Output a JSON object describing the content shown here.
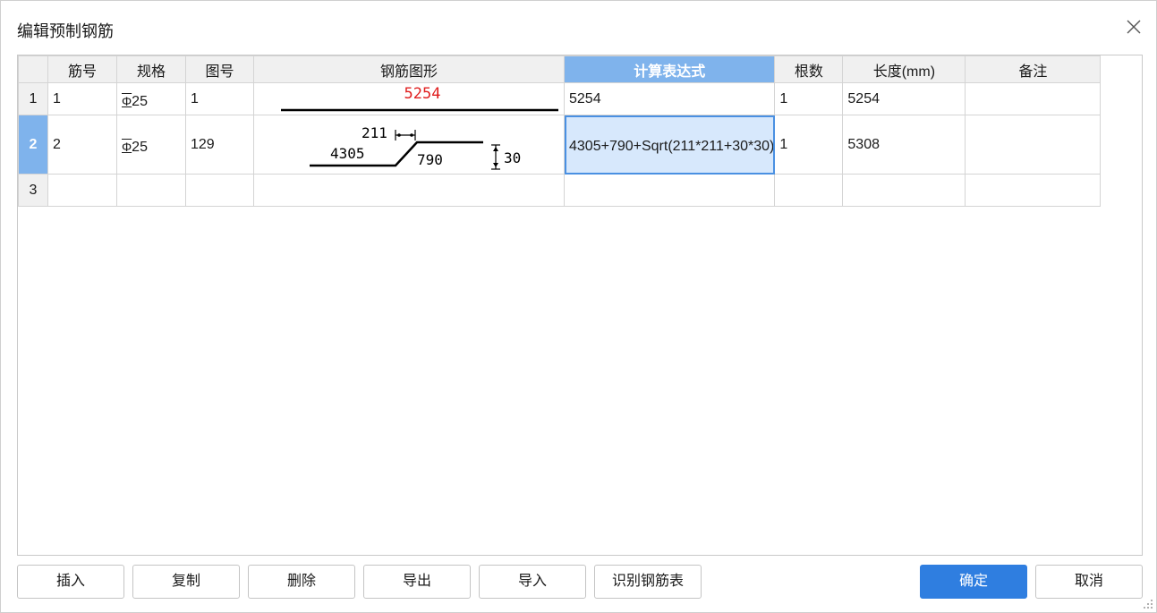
{
  "dialog": {
    "title": "编辑预制钢筋"
  },
  "grid": {
    "columns": [
      {
        "key": "rownum",
        "label": ""
      },
      {
        "key": "bar_no",
        "label": "筋号"
      },
      {
        "key": "spec",
        "label": "规格"
      },
      {
        "key": "fig_no",
        "label": "图号"
      },
      {
        "key": "shape",
        "label": "钢筋图形"
      },
      {
        "key": "formula",
        "label": "计算表达式"
      },
      {
        "key": "count",
        "label": "根数"
      },
      {
        "key": "length",
        "label": "长度(mm)"
      },
      {
        "key": "remark",
        "label": "备注"
      }
    ],
    "active_column": "计算表达式",
    "rows": [
      {
        "rownum": "1",
        "bar_no": "1",
        "spec_symbol": "Φ",
        "spec_size": "25",
        "fig_no": "1",
        "shape": {
          "type": "straight",
          "length_label": "5254",
          "label_color": "#e02020"
        },
        "formula": "5254",
        "count": "1",
        "length": "5254",
        "remark": ""
      },
      {
        "rownum": "2",
        "bar_no": "2",
        "spec_symbol": "Φ",
        "spec_size": "25",
        "fig_no": "129",
        "shape": {
          "type": "cranked",
          "horizontal_label": "211",
          "left_label": "4305",
          "slope_label": "790",
          "height_label": "30"
        },
        "formula": "4305+790+Sqrt(211*211+30*30)",
        "count": "1",
        "length": "5308",
        "remark": "",
        "selected": true
      },
      {
        "rownum": "3",
        "bar_no": "",
        "spec_symbol": "",
        "spec_size": "",
        "fig_no": "",
        "formula": "",
        "count": "",
        "length": "",
        "remark": ""
      }
    ]
  },
  "buttons": {
    "insert": "插入",
    "copy": "复制",
    "delete": "删除",
    "export": "导出",
    "import": "导入",
    "recognize": "识别钢筋表",
    "ok": "确定",
    "cancel": "取消"
  },
  "colors": {
    "accent": "#2f7ee0",
    "header_active": "#7fb3ec",
    "selection_fill": "#d7e8fc",
    "shape_label_red": "#e02020"
  }
}
